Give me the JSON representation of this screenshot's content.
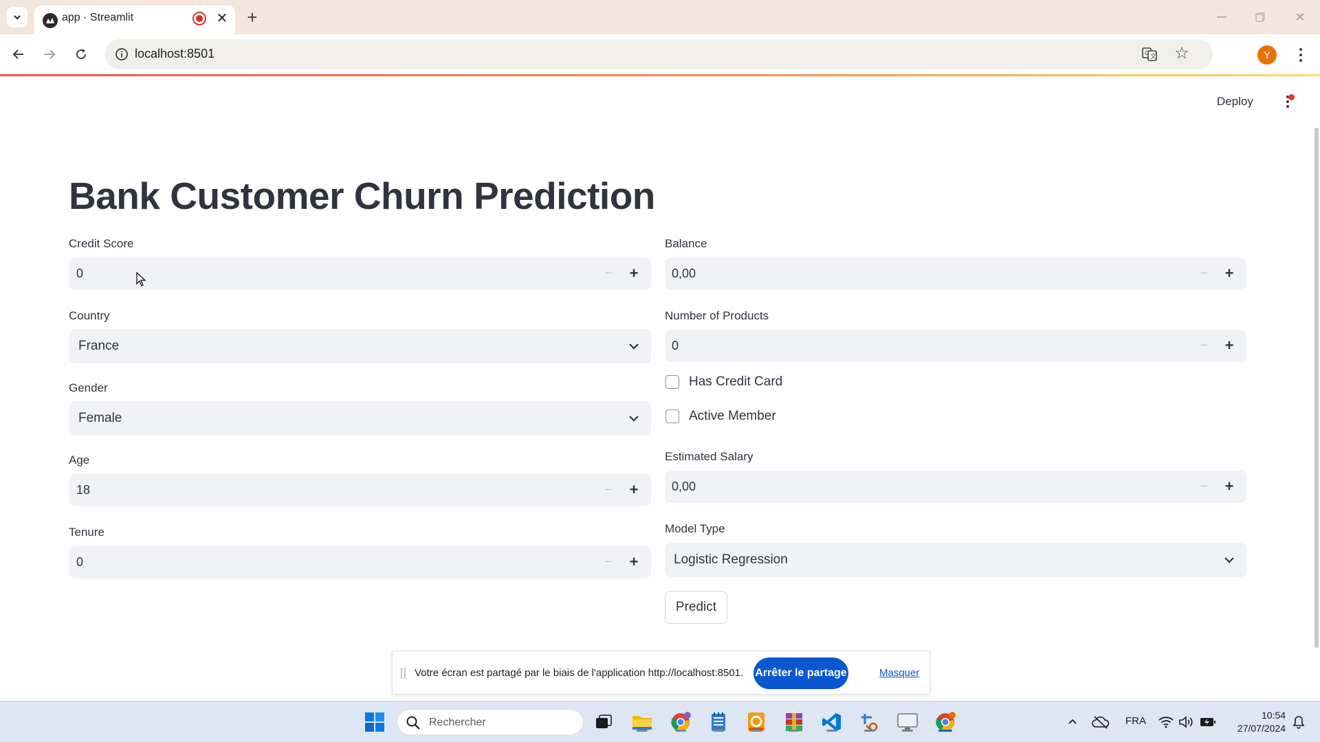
{
  "browser": {
    "tab_title": "app · Streamlit",
    "url": "localhost:8501",
    "profile_initial": "Y"
  },
  "app": {
    "deploy_label": "Deploy",
    "title": "Bank Customer Churn Prediction",
    "left_column": {
      "credit_score": {
        "label": "Credit Score",
        "value": "0",
        "minus": "−",
        "plus": "+"
      },
      "country": {
        "label": "Country",
        "value": "France"
      },
      "gender": {
        "label": "Gender",
        "value": "Female"
      },
      "age": {
        "label": "Age",
        "value": "18",
        "minus": "−",
        "plus": "+"
      },
      "tenure": {
        "label": "Tenure",
        "value": "0",
        "minus": "−",
        "plus": "+"
      }
    },
    "right_column": {
      "balance": {
        "label": "Balance",
        "value": "0,00",
        "minus": "−",
        "plus": "+"
      },
      "num_products": {
        "label": "Number of Products",
        "value": "0",
        "minus": "−",
        "plus": "+"
      },
      "has_credit_card": {
        "label": "Has Credit Card",
        "checked": false
      },
      "active_member": {
        "label": "Active Member",
        "checked": false
      },
      "estimated_salary": {
        "label": "Estimated Salary",
        "value": "0,00",
        "minus": "−",
        "plus": "+"
      },
      "model_type": {
        "label": "Model Type",
        "value": "Logistic Regression"
      },
      "predict_label": "Predict"
    }
  },
  "share_bar": {
    "message": "Votre écran est partagé par le biais de l'application http://localhost:8501.",
    "stop_label": "Arrêter le partage",
    "hide_label": "Masquer"
  },
  "taskbar": {
    "search_placeholder": "Rechercher",
    "language": "FRA",
    "time": "10:54",
    "date": "27/07/2024"
  },
  "colors": {
    "accent_red": "#ff4b4b",
    "input_bg": "#f0f2f6",
    "share_blue": "#0b57d0"
  }
}
